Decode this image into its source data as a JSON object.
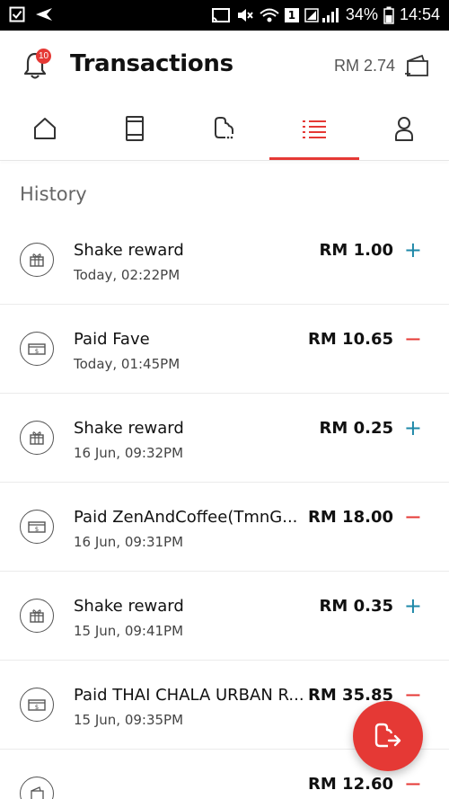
{
  "status_bar": {
    "battery_percent": "34%",
    "time": "14:54",
    "sim_badge": "1"
  },
  "header": {
    "title": "Transactions",
    "notification_count": "10",
    "balance": "RM 2.74"
  },
  "tabs": [
    {
      "name": "home",
      "icon": "home-icon",
      "active": false
    },
    {
      "name": "device",
      "icon": "phone-icon",
      "active": false
    },
    {
      "name": "payment",
      "icon": "payment-icon",
      "active": false
    },
    {
      "name": "transactions",
      "icon": "list-icon",
      "active": true
    },
    {
      "name": "profile",
      "icon": "person-icon",
      "active": false
    }
  ],
  "colors": {
    "accent": "#e53935",
    "plus": "#1e88a8",
    "minus": "#e53935"
  },
  "history": {
    "title": "History",
    "items": [
      {
        "icon": "gift-icon",
        "title": "Shake reward",
        "date": "Today, 02:22PM",
        "amount": "RM 1.00",
        "sign": "+"
      },
      {
        "icon": "cash-icon",
        "title": "Paid Fave",
        "date": "Today, 01:45PM",
        "amount": "RM 10.65",
        "sign": "−"
      },
      {
        "icon": "gift-icon",
        "title": "Shake reward",
        "date": "16 Jun, 09:32PM",
        "amount": "RM 0.25",
        "sign": "+"
      },
      {
        "icon": "cash-icon",
        "title": "Paid ZenAndCoffee(TmnG...",
        "date": "16 Jun, 09:31PM",
        "amount": "RM 18.00",
        "sign": "−"
      },
      {
        "icon": "gift-icon",
        "title": "Shake reward",
        "date": "15 Jun, 09:41PM",
        "amount": "RM 0.35",
        "sign": "+"
      },
      {
        "icon": "cash-icon",
        "title": "Paid THAI CHALA URBAN R...",
        "date": "15 Jun, 09:35PM",
        "amount": "RM 35.85",
        "sign": "−"
      },
      {
        "icon": "wallet-icon",
        "title": "",
        "date": "",
        "amount": "RM 12.60",
        "sign": "−"
      }
    ]
  }
}
